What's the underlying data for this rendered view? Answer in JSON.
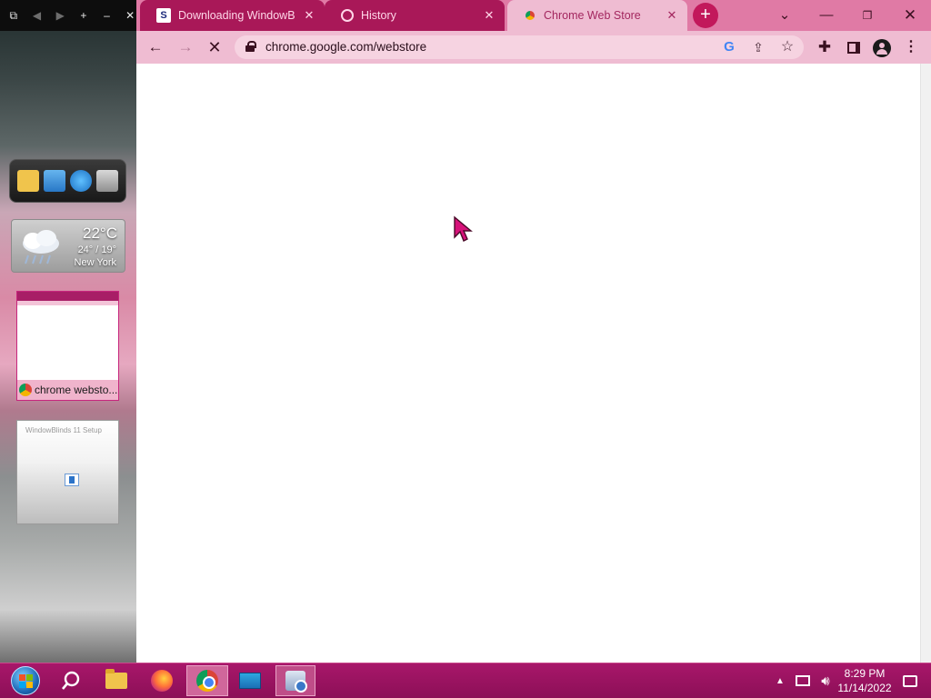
{
  "sidebar": {
    "weather": {
      "temperature": "22°C",
      "range": "24° / 19°",
      "city": "New York"
    },
    "thumbnails": [
      {
        "caption": "chrome websto..."
      },
      {
        "title": "WindowBlinds 11 Setup"
      }
    ]
  },
  "browser": {
    "tabs": [
      {
        "label": "Downloading WindowBlinds",
        "icon": "stardock-icon",
        "active": false
      },
      {
        "label": "History",
        "icon": "history-icon",
        "active": false
      },
      {
        "label": "Chrome Web Store",
        "icon": "chrome-webstore-icon",
        "active": true
      }
    ],
    "address_bar": {
      "url": "chrome.google.com/webstore"
    },
    "colors": {
      "tabstrip": "#e07aa5",
      "inactive_tab": "#a91858",
      "active_tab": "#efbcd2",
      "new_tab_button": "#c2185b"
    }
  },
  "taskbar": {
    "apps": [
      {
        "name": "start",
        "icon": "windows-start-icon"
      },
      {
        "name": "search",
        "icon": "search-icon"
      },
      {
        "name": "file-explorer",
        "icon": "folder-icon"
      },
      {
        "name": "firefox",
        "icon": "firefox-icon"
      },
      {
        "name": "chrome",
        "icon": "chrome-icon",
        "active": true
      },
      {
        "name": "desktop",
        "icon": "monitor-icon"
      },
      {
        "name": "windowblinds-setup",
        "icon": "setup-icon",
        "active": true
      }
    ],
    "clock": {
      "time": "8:29 PM",
      "date": "11/14/2022"
    },
    "color": "#a8176a"
  }
}
